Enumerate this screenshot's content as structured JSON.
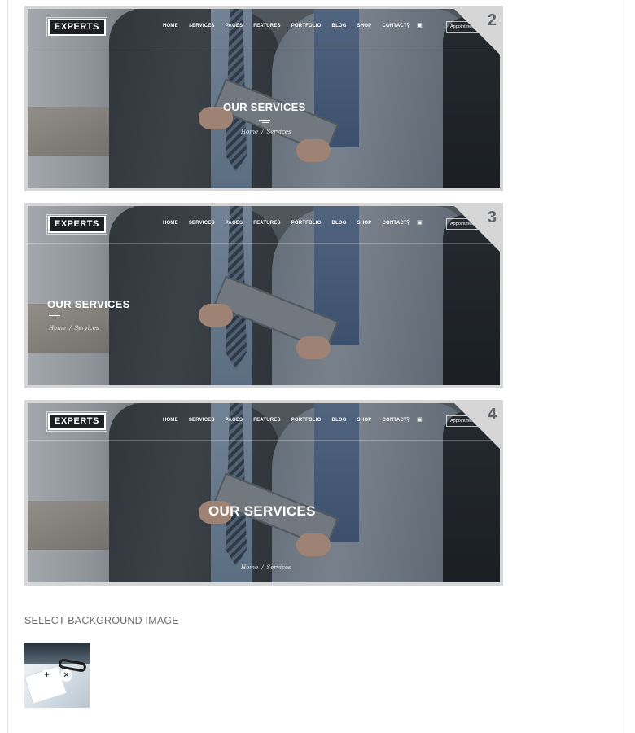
{
  "layouts": [
    {
      "number": "2",
      "title": "OUR SERVICES",
      "crumb_home": "Home",
      "crumb_sep": "/",
      "crumb_current": "Services"
    },
    {
      "number": "3",
      "title": "OUR SERVICES",
      "crumb_home": "Home",
      "crumb_sep": "/",
      "crumb_current": "Services"
    },
    {
      "number": "4",
      "title": "OUR SERVICES",
      "crumb_home": "Home",
      "crumb_sep": "/",
      "crumb_current": "Services"
    }
  ],
  "site": {
    "logo": "EXPERTS",
    "nav": [
      "HOME",
      "SERVICES",
      "PAGES",
      "FEATURES",
      "PORTFOLIO",
      "BLOG",
      "SHOP",
      "CONTACT"
    ],
    "icons": [
      "search-icon",
      "cart-icon"
    ],
    "appointment": "Appointment"
  },
  "background": {
    "label": "SELECT BACKGROUND IMAGE",
    "add_symbol": "+",
    "remove_symbol": "×"
  },
  "colors": {
    "frame": "#d6d6d6",
    "corner_number": "#5f6368",
    "label": "#6b6b6b"
  }
}
